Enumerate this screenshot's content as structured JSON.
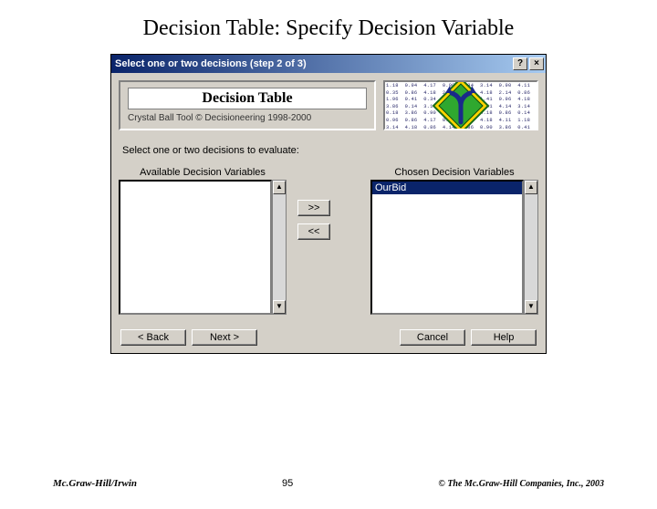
{
  "slide": {
    "title": "Decision Table: Specify Decision Variable"
  },
  "dialog": {
    "titlebar": "Select one or two decisions (step 2 of 3)",
    "help_btn": "?",
    "close_btn": "×",
    "brand_title": "Decision Table",
    "brand_sub": "Crystal Ball Tool © Decisioneering 1998-2000",
    "instruction": "Select one or two decisions to evaluate:",
    "available_label": "Available Decision Variables",
    "chosen_label": "Chosen Decision Variables",
    "available_items": [],
    "chosen_items": [
      "OurBid"
    ],
    "move_right": ">>",
    "move_left": "<<",
    "buttons": {
      "back": "< Back",
      "next": "Next >",
      "cancel": "Cancel",
      "help": "Help"
    },
    "art_numbers": "1.18  0.94  4.17  0.90  0.34  3.14  0.90  4.11  0.02\n0.35  0.86  4.18  2.14  3.86  4.18  2.14  0.86  0.35\n1.96  0.41  0.34  1.18  0.96  1.41  0.96  4.18  4.14\n3.86  0.14  3.14  0.90  4.18  0.41  4.14  3.14  0.86\n0.18  3.86  0.90  4.11  0.96  4.18  0.86  0.14  8.14\n0.96  0.86  4.17  0.34  3.14  4.18  4.11  1.18  0.90\n3.14  4.18  0.86  4.14  0.86  0.90  3.86  0.41  4.11\n0.86  0.41  4.18  0.96  4.18  4.14  0.14  3.14  0.34\n4.11  0.90  0.34  1.18  3.86  0.41  4.18  0.86  0.96"
  },
  "footer": {
    "left": "Mc.Graw-Hill/Irwin",
    "center": "95",
    "right": "© The Mc.Graw-Hill Companies, Inc., 2003"
  }
}
